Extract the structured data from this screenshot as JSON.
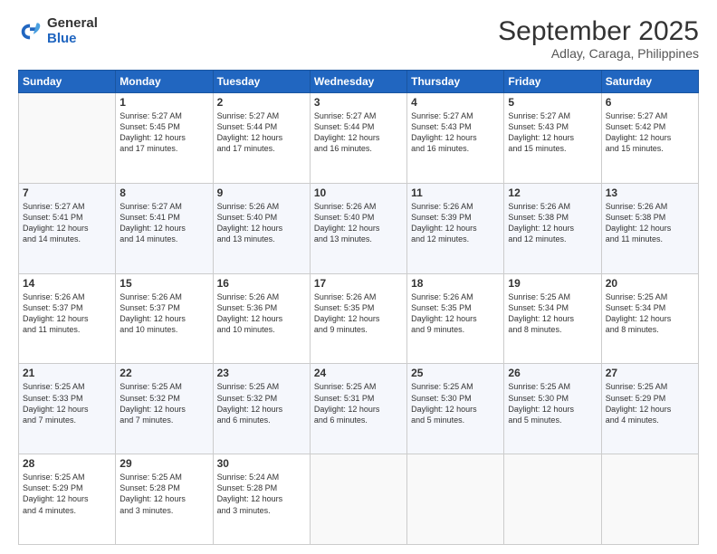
{
  "logo": {
    "general": "General",
    "blue": "Blue"
  },
  "title": "September 2025",
  "subtitle": "Adlay, Caraga, Philippines",
  "headers": [
    "Sunday",
    "Monday",
    "Tuesday",
    "Wednesday",
    "Thursday",
    "Friday",
    "Saturday"
  ],
  "weeks": [
    [
      {
        "day": "",
        "text": ""
      },
      {
        "day": "1",
        "text": "Sunrise: 5:27 AM\nSunset: 5:45 PM\nDaylight: 12 hours\nand 17 minutes."
      },
      {
        "day": "2",
        "text": "Sunrise: 5:27 AM\nSunset: 5:44 PM\nDaylight: 12 hours\nand 17 minutes."
      },
      {
        "day": "3",
        "text": "Sunrise: 5:27 AM\nSunset: 5:44 PM\nDaylight: 12 hours\nand 16 minutes."
      },
      {
        "day": "4",
        "text": "Sunrise: 5:27 AM\nSunset: 5:43 PM\nDaylight: 12 hours\nand 16 minutes."
      },
      {
        "day": "5",
        "text": "Sunrise: 5:27 AM\nSunset: 5:43 PM\nDaylight: 12 hours\nand 15 minutes."
      },
      {
        "day": "6",
        "text": "Sunrise: 5:27 AM\nSunset: 5:42 PM\nDaylight: 12 hours\nand 15 minutes."
      }
    ],
    [
      {
        "day": "7",
        "text": "Sunrise: 5:27 AM\nSunset: 5:41 PM\nDaylight: 12 hours\nand 14 minutes."
      },
      {
        "day": "8",
        "text": "Sunrise: 5:27 AM\nSunset: 5:41 PM\nDaylight: 12 hours\nand 14 minutes."
      },
      {
        "day": "9",
        "text": "Sunrise: 5:26 AM\nSunset: 5:40 PM\nDaylight: 12 hours\nand 13 minutes."
      },
      {
        "day": "10",
        "text": "Sunrise: 5:26 AM\nSunset: 5:40 PM\nDaylight: 12 hours\nand 13 minutes."
      },
      {
        "day": "11",
        "text": "Sunrise: 5:26 AM\nSunset: 5:39 PM\nDaylight: 12 hours\nand 12 minutes."
      },
      {
        "day": "12",
        "text": "Sunrise: 5:26 AM\nSunset: 5:38 PM\nDaylight: 12 hours\nand 12 minutes."
      },
      {
        "day": "13",
        "text": "Sunrise: 5:26 AM\nSunset: 5:38 PM\nDaylight: 12 hours\nand 11 minutes."
      }
    ],
    [
      {
        "day": "14",
        "text": "Sunrise: 5:26 AM\nSunset: 5:37 PM\nDaylight: 12 hours\nand 11 minutes."
      },
      {
        "day": "15",
        "text": "Sunrise: 5:26 AM\nSunset: 5:37 PM\nDaylight: 12 hours\nand 10 minutes."
      },
      {
        "day": "16",
        "text": "Sunrise: 5:26 AM\nSunset: 5:36 PM\nDaylight: 12 hours\nand 10 minutes."
      },
      {
        "day": "17",
        "text": "Sunrise: 5:26 AM\nSunset: 5:35 PM\nDaylight: 12 hours\nand 9 minutes."
      },
      {
        "day": "18",
        "text": "Sunrise: 5:26 AM\nSunset: 5:35 PM\nDaylight: 12 hours\nand 9 minutes."
      },
      {
        "day": "19",
        "text": "Sunrise: 5:25 AM\nSunset: 5:34 PM\nDaylight: 12 hours\nand 8 minutes."
      },
      {
        "day": "20",
        "text": "Sunrise: 5:25 AM\nSunset: 5:34 PM\nDaylight: 12 hours\nand 8 minutes."
      }
    ],
    [
      {
        "day": "21",
        "text": "Sunrise: 5:25 AM\nSunset: 5:33 PM\nDaylight: 12 hours\nand 7 minutes."
      },
      {
        "day": "22",
        "text": "Sunrise: 5:25 AM\nSunset: 5:32 PM\nDaylight: 12 hours\nand 7 minutes."
      },
      {
        "day": "23",
        "text": "Sunrise: 5:25 AM\nSunset: 5:32 PM\nDaylight: 12 hours\nand 6 minutes."
      },
      {
        "day": "24",
        "text": "Sunrise: 5:25 AM\nSunset: 5:31 PM\nDaylight: 12 hours\nand 6 minutes."
      },
      {
        "day": "25",
        "text": "Sunrise: 5:25 AM\nSunset: 5:30 PM\nDaylight: 12 hours\nand 5 minutes."
      },
      {
        "day": "26",
        "text": "Sunrise: 5:25 AM\nSunset: 5:30 PM\nDaylight: 12 hours\nand 5 minutes."
      },
      {
        "day": "27",
        "text": "Sunrise: 5:25 AM\nSunset: 5:29 PM\nDaylight: 12 hours\nand 4 minutes."
      }
    ],
    [
      {
        "day": "28",
        "text": "Sunrise: 5:25 AM\nSunset: 5:29 PM\nDaylight: 12 hours\nand 4 minutes."
      },
      {
        "day": "29",
        "text": "Sunrise: 5:25 AM\nSunset: 5:28 PM\nDaylight: 12 hours\nand 3 minutes."
      },
      {
        "day": "30",
        "text": "Sunrise: 5:24 AM\nSunset: 5:28 PM\nDaylight: 12 hours\nand 3 minutes."
      },
      {
        "day": "",
        "text": ""
      },
      {
        "day": "",
        "text": ""
      },
      {
        "day": "",
        "text": ""
      },
      {
        "day": "",
        "text": ""
      }
    ]
  ]
}
